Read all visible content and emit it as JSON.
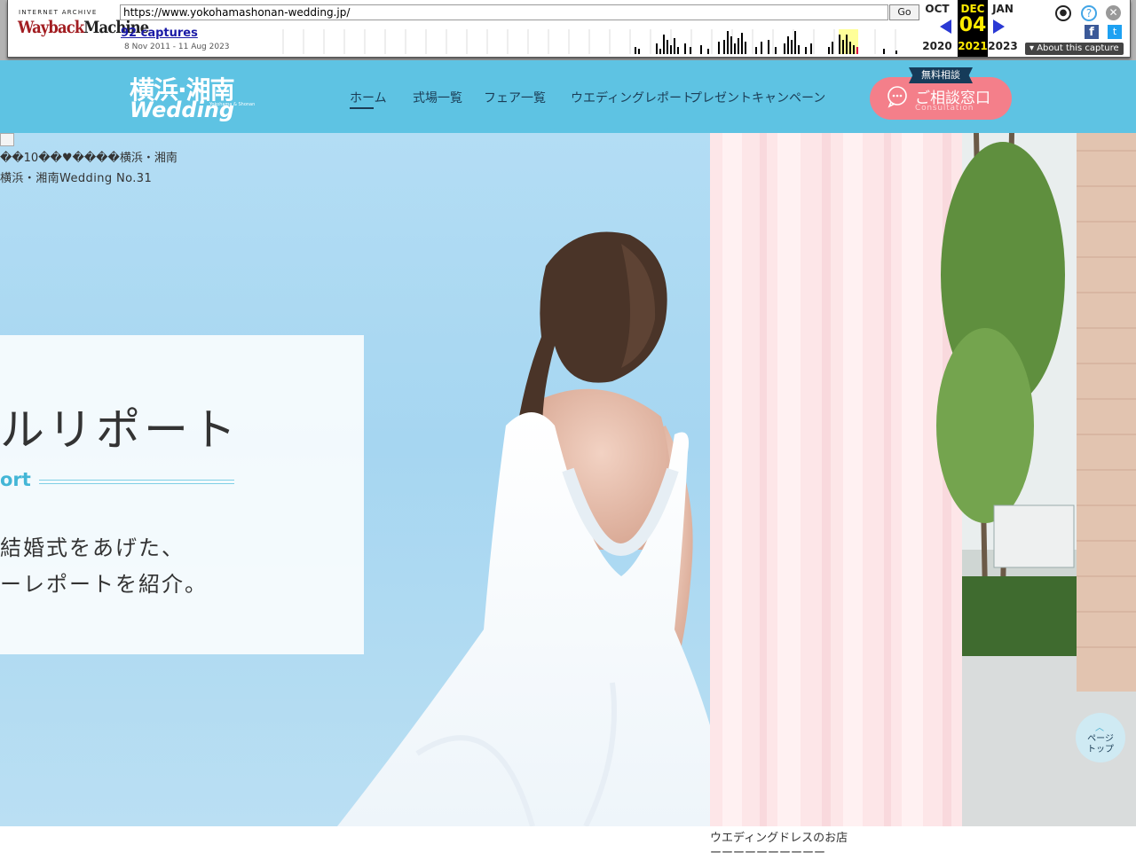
{
  "wayback": {
    "logo_top": "INTERNET ARCHIVE",
    "logo_a": "Wayback",
    "logo_b": "Machine",
    "url": "https://www.yokohamashonan-wedding.jp/",
    "go_label": "Go",
    "captures_label": "92 captures",
    "date_range": "8 Nov 2011 - 11 Aug 2023",
    "prev_month": "OCT",
    "prev_year": "2020",
    "cur_month": "DEC",
    "cur_day": "04",
    "cur_year": "2021",
    "next_month": "JAN",
    "next_year": "2023",
    "about_label": "▾ About this capture",
    "icons": [
      "user-icon",
      "help-icon",
      "close-icon",
      "facebook-icon",
      "twitter-icon"
    ]
  },
  "site": {
    "logo_line1": "横浜·湘南",
    "logo_line2": "Wedding",
    "logo_sub": "Yokohama & Shonan",
    "nav": [
      "ホーム",
      "式場一覧",
      "フェア一覧",
      "ウエディングレポート",
      "プレゼントキャンペーン"
    ],
    "active_nav": 0,
    "consult_tag": "無料相談",
    "consult_label": "ご相談窓口",
    "consult_sub": "Consultation",
    "brand_color": "#5ec3e3",
    "accent_pink": "#f47f8a",
    "navy": "#163b59"
  },
  "hero": {
    "caption1": "��10��♥����横浜・湘南",
    "caption2": "横浜・湘南Wedding No.31",
    "title": "ルリポート",
    "subtitle": "ort",
    "desc1": "結婚式をあげた、",
    "desc2": "ーレポートを紹介。"
  },
  "footer_caption": {
    "line1": "ウエディングドレスのお店",
    "line2": "ーーーーーーーーーー"
  },
  "pagetop": {
    "label": "ページトップ"
  }
}
